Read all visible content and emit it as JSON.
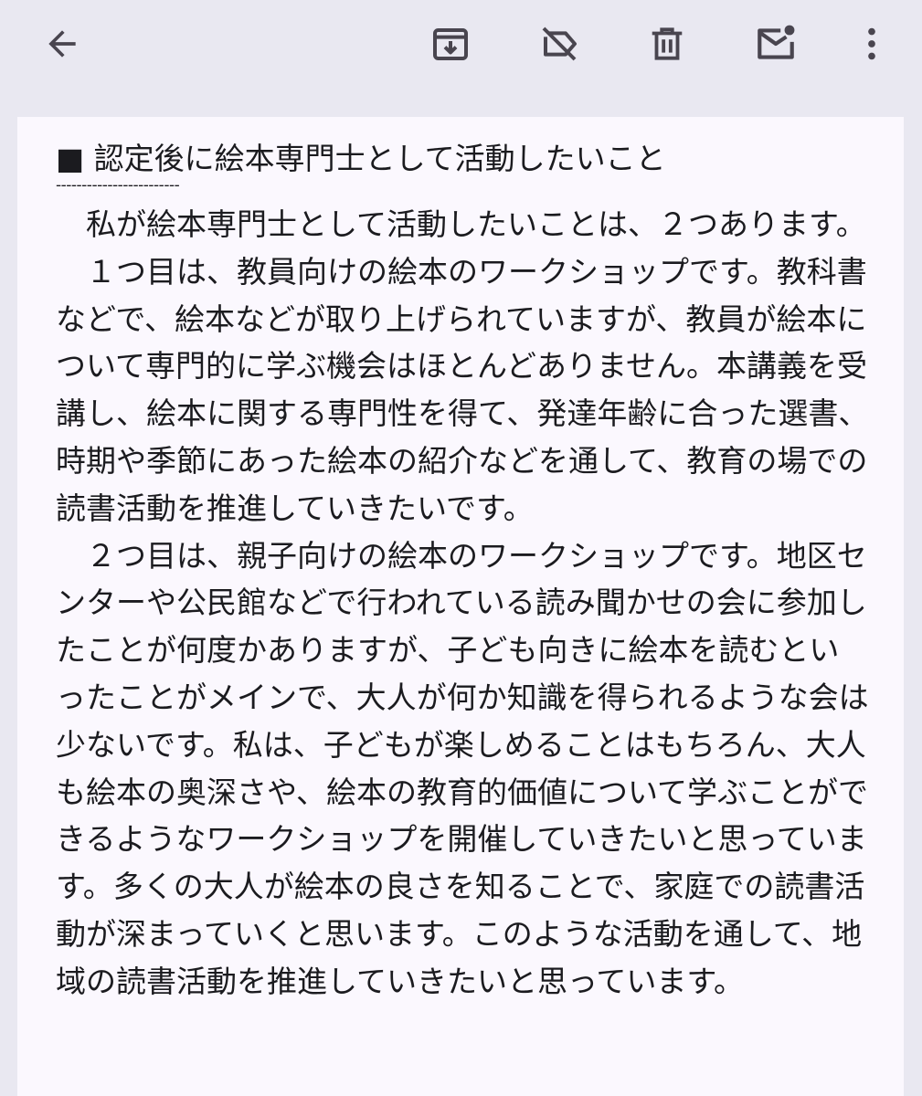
{
  "toolbar": {
    "back_icon": "arrow-back-icon",
    "archive_icon": "archive-icon",
    "label_off_icon": "label-off-icon",
    "delete_icon": "trash-icon",
    "mark_unread_icon": "mail-unread-icon",
    "more_icon": "more-vert-icon",
    "icon_color": "#49454f"
  },
  "message": {
    "heading": "■ 認定後に絵本専門士として活動したいこと",
    "divider": "------------------------",
    "paragraphs": [
      "私が絵本専門士として活動したいことは、２つあります。",
      "１つ目は、教員向けの絵本のワークショップです。教科書などで、絵本などが取り上げられていますが、教員が絵本について専門的に学ぶ機会はほとんどありません。本講義を受講し、絵本に関する専門性を得て、発達年齢に合った選書、時期や季節にあった絵本の紹介などを通して、教育の場での読書活動を推進していきたいです。",
      "２つ目は、親子向けの絵本のワークショップです。地区センターや公民館などで行われている読み聞かせの会に参加したことが何度かありますが、子ども向きに絵本を読むといったことがメインで、大人が何か知識を得られるような会は少ないです。私は、子どもが楽しめることはもちろん、大人も絵本の奥深さや、絵本の教育的価値について学ぶことができるようなワークショップを開催していきたいと思っています。多くの大人が絵本の良さを知ることで、家庭での読書活動が深まっていくと思います。このような活動を通して、地域の読書活動を推進していきたいと思っています。"
    ]
  },
  "colors": {
    "appbar_bg": "#e9e8f1",
    "content_bg": "#fbf8fe",
    "text": "#1b1b1f"
  }
}
